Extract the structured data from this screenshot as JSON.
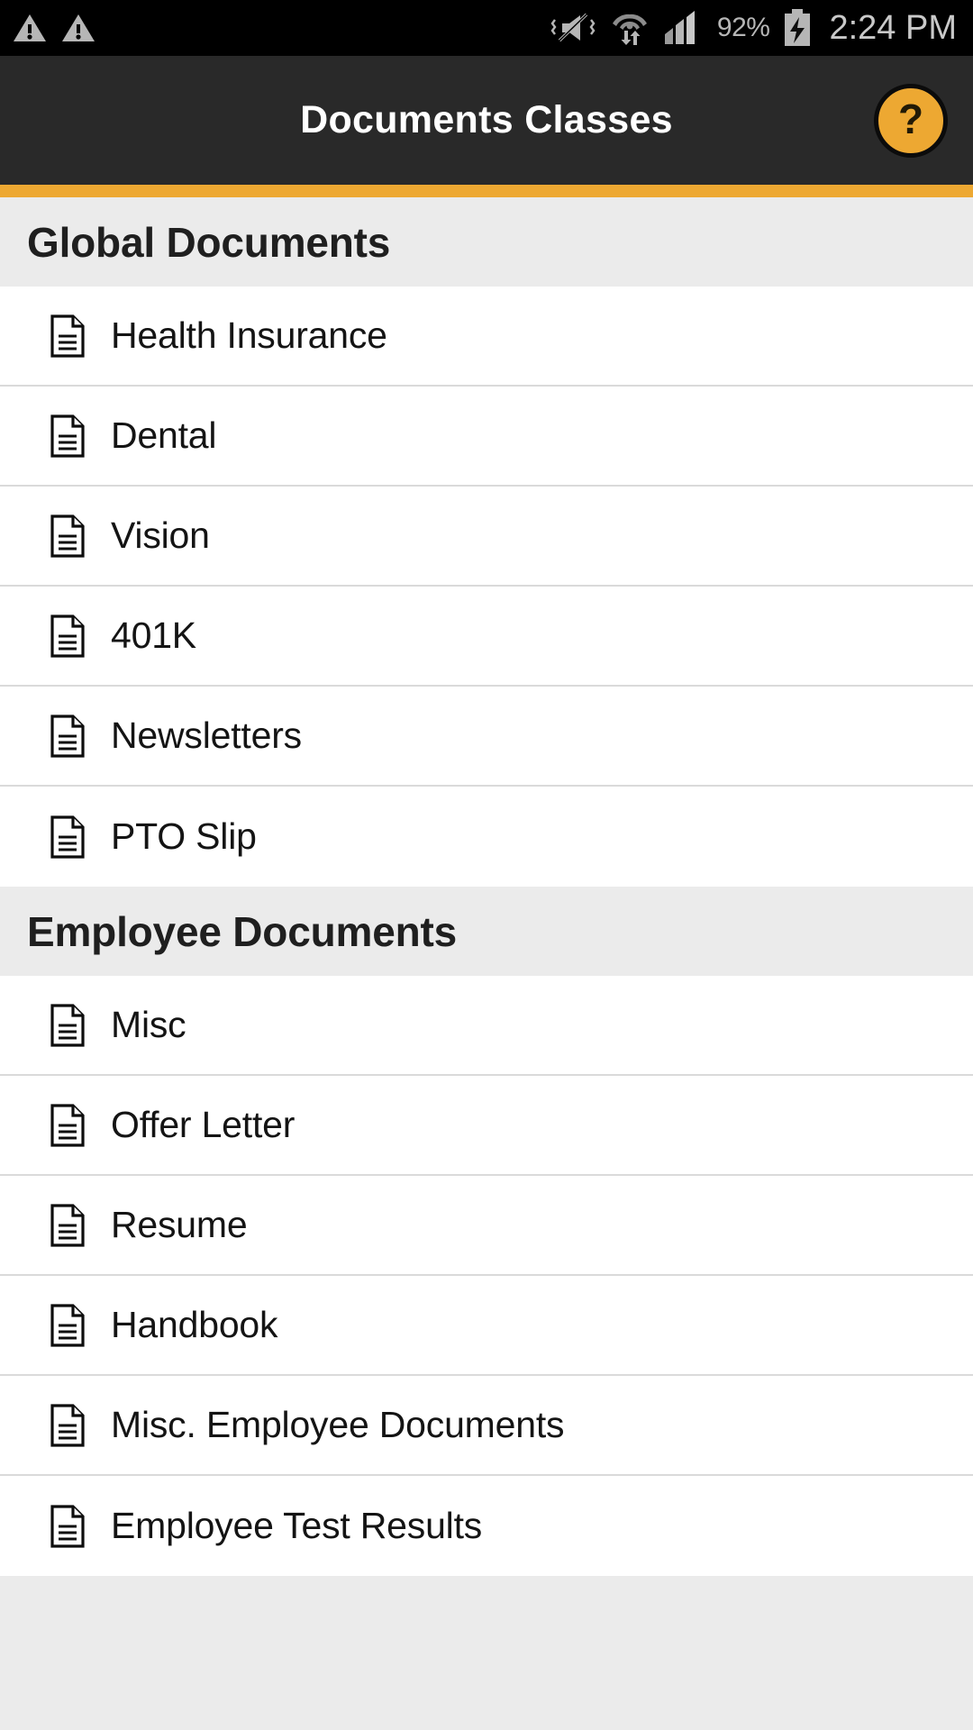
{
  "status_bar": {
    "icons_left": [
      "warning-triangle-icon",
      "warning-triangle-icon"
    ],
    "icons_right": [
      "vibrate-off-icon",
      "wifi-data-transfer-icon",
      "cellular-signal-icon"
    ],
    "battery_percent": "92%",
    "battery_state": "charging",
    "time": "2:24 PM"
  },
  "title_bar": {
    "title": "Documents Classes",
    "help_label": "?"
  },
  "colors": {
    "accent": "#eda832",
    "title_bar_bg": "#292929",
    "status_bar_bg": "#000000",
    "section_header_bg": "#ebebeb",
    "row_bg": "#ffffff",
    "separator": "#dadada",
    "text_primary": "#141414"
  },
  "sections": [
    {
      "title": "Global Documents",
      "items": [
        {
          "label": "Health Insurance",
          "icon": "document-icon"
        },
        {
          "label": "Dental",
          "icon": "document-icon"
        },
        {
          "label": "Vision",
          "icon": "document-icon"
        },
        {
          "label": "401K",
          "icon": "document-icon"
        },
        {
          "label": "Newsletters",
          "icon": "document-icon"
        },
        {
          "label": "PTO Slip",
          "icon": "document-icon"
        }
      ]
    },
    {
      "title": "Employee Documents",
      "items": [
        {
          "label": "Misc",
          "icon": "document-icon"
        },
        {
          "label": "Offer Letter",
          "icon": "document-icon"
        },
        {
          "label": "Resume",
          "icon": "document-icon"
        },
        {
          "label": "Handbook",
          "icon": "document-icon"
        },
        {
          "label": "Misc. Employee Documents",
          "icon": "document-icon"
        },
        {
          "label": "Employee Test Results",
          "icon": "document-icon"
        }
      ]
    }
  ]
}
